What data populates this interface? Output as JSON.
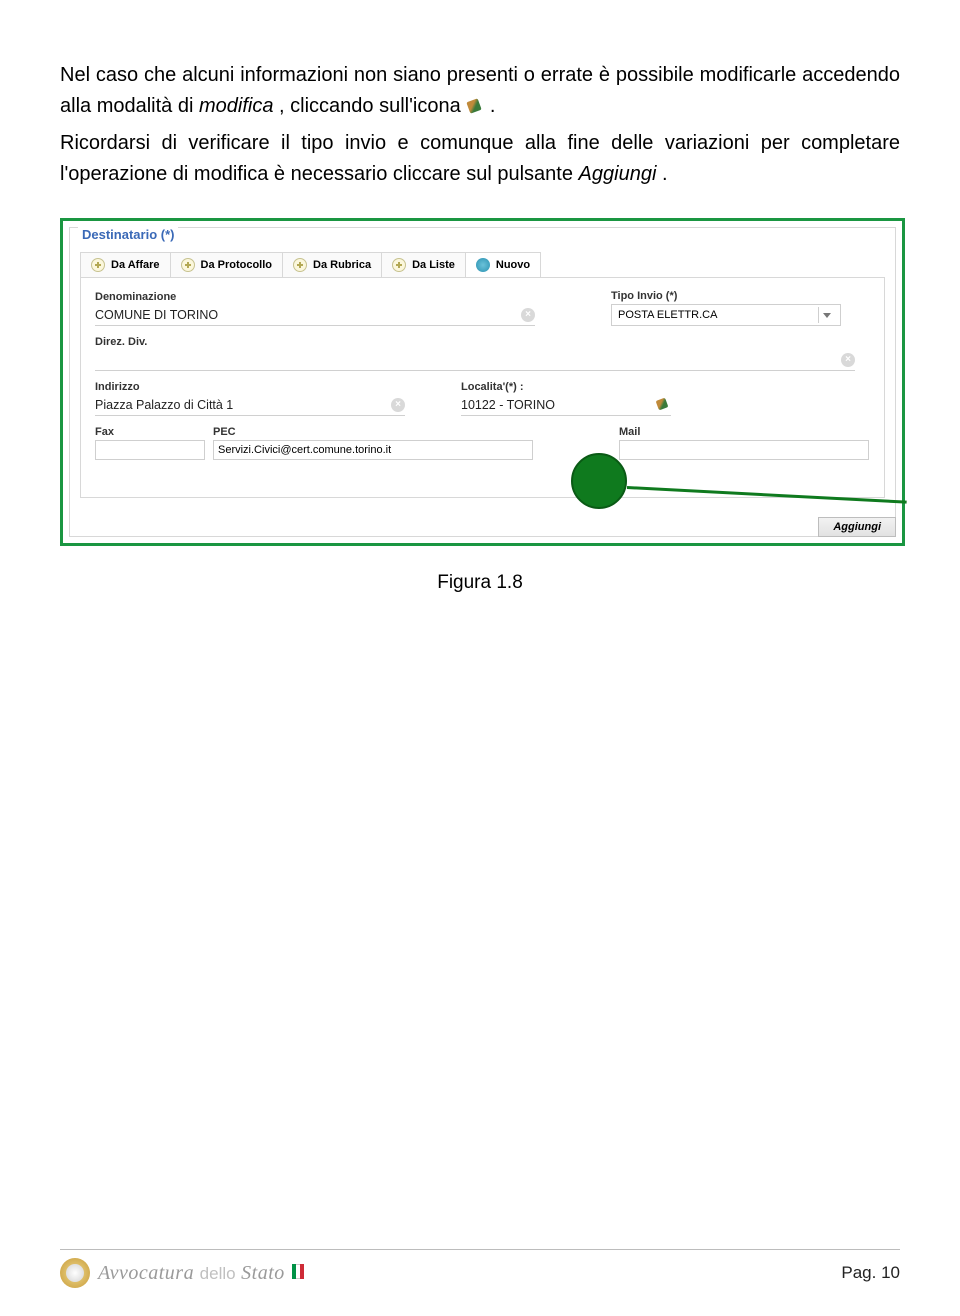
{
  "text": {
    "p1a": "Nel caso che alcuni informazioni non siano presenti o errate è possibile modificarle accedendo alla modalità di ",
    "p1b": "modifica",
    "p1c": ",  cliccando sull'icona ",
    "p1d": " .",
    "p2a": "Ricordarsi di verificare il tipo invio e comunque alla fine delle variazioni per completare l'operazione di modifica è necessario cliccare sul pulsante ",
    "p2b": "Aggiungi",
    "p2c": ".",
    "caption": "Figura 1.8"
  },
  "form": {
    "legend": "Destinatario (*)",
    "tabs": [
      {
        "label": "Da Affare",
        "icon": "plus"
      },
      {
        "label": "Da Protocollo",
        "icon": "plus"
      },
      {
        "label": "Da Rubrica",
        "icon": "plus"
      },
      {
        "label": "Da Liste",
        "icon": "plus"
      },
      {
        "label": "Nuovo",
        "icon": "dot",
        "active": true
      }
    ],
    "denominazione": {
      "label": "Denominazione",
      "value": "COMUNE DI TORINO"
    },
    "tipoinvio": {
      "label": "Tipo Invio (*)",
      "value": "POSTA ELETTR.CA"
    },
    "direz": {
      "label": "Direz. Div.",
      "value": ""
    },
    "indirizzo": {
      "label": "Indirizzo",
      "value": "Piazza Palazzo di Città 1"
    },
    "localita": {
      "label": "Localita'(*) :",
      "value": "10122 - TORINO"
    },
    "fax": {
      "label": "Fax",
      "value": ""
    },
    "pec": {
      "label": "PEC",
      "value": "Servizi.Civici@cert.comune.torino.it"
    },
    "mail": {
      "label": "Mail",
      "value": ""
    },
    "aggiungi": "Aggiungi"
  },
  "footer": {
    "brand1": "Avvocatura",
    "brand2": "dello",
    "brand3": "Stato",
    "page": "Pag. 10"
  }
}
